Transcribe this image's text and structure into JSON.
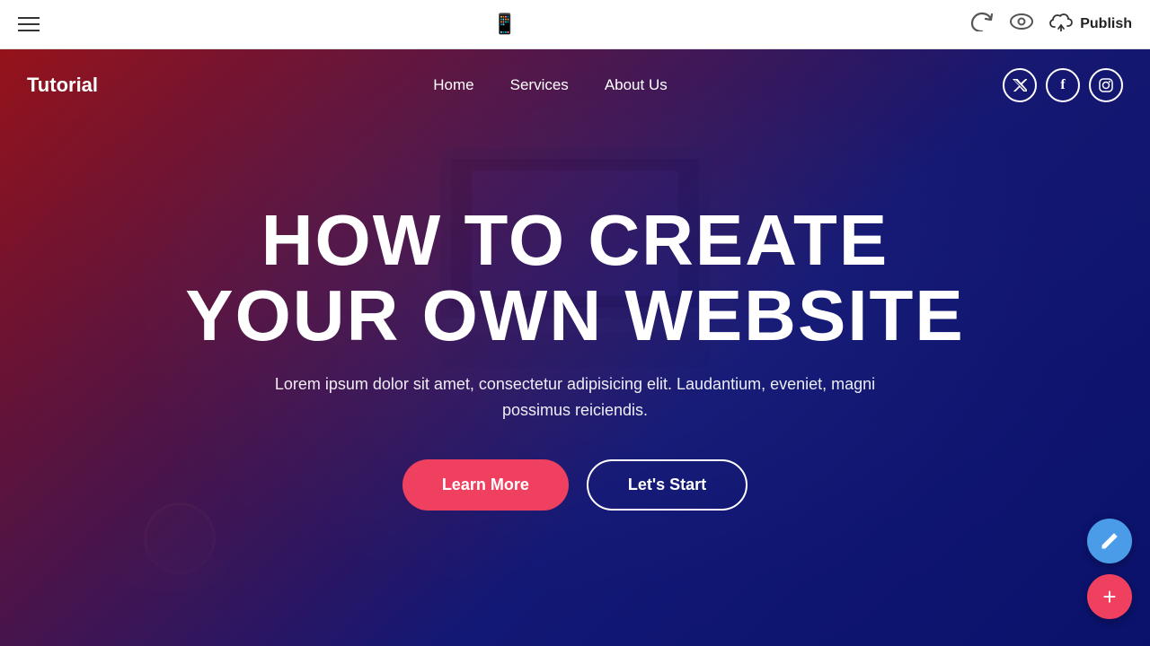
{
  "toolbar": {
    "hamburger_label": "menu",
    "phone_icon": "📱",
    "undo_label": "↩",
    "eye_label": "👁",
    "publish_label": "Publish",
    "cloud_icon": "☁"
  },
  "site": {
    "logo": "Tutorial",
    "nav": {
      "links": [
        {
          "label": "Home",
          "href": "#"
        },
        {
          "label": "Services",
          "href": "#"
        },
        {
          "label": "About Us",
          "href": "#"
        }
      ]
    },
    "social": {
      "twitter": "𝕏",
      "facebook": "f",
      "instagram": "📷"
    },
    "hero": {
      "title_line1": "HOW TO CREATE",
      "title_line2": "YOUR OWN WEBSITE",
      "subtitle": "Lorem ipsum dolor sit amet, consectetur adipisicing elit. Laudantium, eveniet, magni possimus reiciendis.",
      "btn_learn_more": "Learn More",
      "btn_lets_start": "Let's Start"
    }
  },
  "fab": {
    "pencil_icon": "✏",
    "plus_icon": "+"
  }
}
